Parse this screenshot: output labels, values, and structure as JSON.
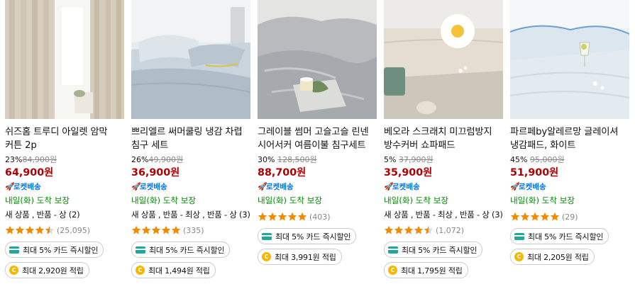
{
  "products": [
    {
      "title": "쉬즈홈 트루디 아일렛 암막 커튼 2p",
      "discount": "23%",
      "original_price": "84,900원",
      "price": "64,900원",
      "delivery_badge": "로켓배송",
      "arrival": "내일(화) 도착 보장",
      "condition": "새 상품 , 반품 - 상 (2)",
      "rating": 4.5,
      "review_count": "(25,095)",
      "card_discount": "최대 5% 카드 즉시할인",
      "points": "최대 2,920원 적립"
    },
    {
      "title": "쁘리엘르 써머쿨링 냉감 차렵 침구 세트",
      "discount": "26%",
      "original_price": "49,900원",
      "price": "36,900원",
      "delivery_badge": "로켓배송",
      "arrival": "내일(화) 도착 보장",
      "condition": "새 상품 , 반품 - 최상 , 반품 - 상 (3)",
      "rating": 5,
      "review_count": "(335)",
      "card_discount": "최대 5% 카드 즉시할인",
      "points": "최대 1,494원 적립"
    },
    {
      "title": "그레이블 썸머 고슬고슬 린넨 시어서커 여름이불 침구세트",
      "discount": "30%",
      "original_price": "128,500원",
      "price": "88,700원",
      "delivery_badge": "로켓배송",
      "arrival": "내일(화) 도착 보장",
      "condition": "",
      "rating": 5,
      "review_count": "(403)",
      "card_discount": "최대 5% 카드 즉시할인",
      "points": "최대 3,991원 적립"
    },
    {
      "title": "베오라 스크래치 미끄럼방지 방수커버 쇼파패드",
      "discount": "5%",
      "original_price": "37,900원",
      "price": "35,900원",
      "delivery_badge": "로켓배송",
      "arrival": "내일(화) 도착 보장",
      "condition": "새 상품 , 반품 - 최상 , 반품 - 상 (3)",
      "rating": 4.5,
      "review_count": "(1,072)",
      "card_discount": "최대 5% 카드 즉시할인",
      "points": "최대 1,795원 적립"
    },
    {
      "title": "파르페by알레르망 글레이셔 냉감패드, 화이트",
      "discount": "45%",
      "original_price": "95,000원",
      "price": "51,900원",
      "delivery_badge": "로켓배송",
      "arrival": "내일(화) 도착 보장",
      "condition": "",
      "rating": 5,
      "review_count": "(29)",
      "card_discount": "최대 5% 카드 즉시할인",
      "points": "최대 2,205원 적립"
    }
  ],
  "colors": {
    "price": "#ae0000",
    "rocket": "#0073e9",
    "arrival": "#008c00",
    "star": "#f28b00",
    "card_icon": "#20a8a0",
    "coin_icon": "#f5b800"
  },
  "icons": {
    "rocket": "rocket-icon",
    "star": "star-icon",
    "card": "credit-card-icon",
    "coin": "coin-icon"
  }
}
